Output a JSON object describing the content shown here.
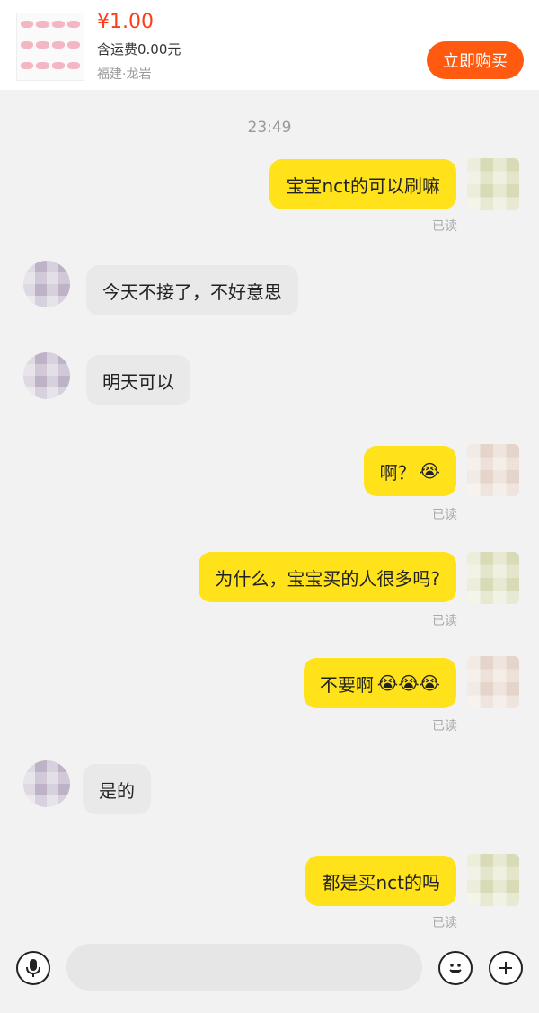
{
  "product": {
    "price": "¥1.00",
    "shipping": "含运费0.00元",
    "location": "福建·龙岩",
    "buy_button": "立即购买"
  },
  "timestamp": "23:49",
  "messages": [
    {
      "from": "self",
      "text": "宝宝nct的可以刷嘛",
      "status": "已读"
    },
    {
      "from": "other",
      "text": "今天不接了，不好意思"
    },
    {
      "from": "other",
      "text": "明天可以"
    },
    {
      "from": "self",
      "text": "啊？",
      "emoji": "😭",
      "status": "已读"
    },
    {
      "from": "self",
      "text": "为什么，宝宝买的人很多吗?",
      "status": "已读"
    },
    {
      "from": "self",
      "text": "不要啊",
      "emoji": "😭😭😭",
      "status": "已读"
    },
    {
      "from": "other",
      "text": "是的"
    },
    {
      "from": "self",
      "text": "都是买nct的吗",
      "status": "已读"
    }
  ],
  "input": {
    "voice_icon": "microphone-icon",
    "emoji_icon": "smiley-icon",
    "plus_icon": "plus-icon"
  },
  "colors": {
    "sent_bubble": "#ffe21a",
    "received_bubble": "#e9e9e9",
    "accent": "#ff5a10",
    "price": "#ff3d17"
  }
}
